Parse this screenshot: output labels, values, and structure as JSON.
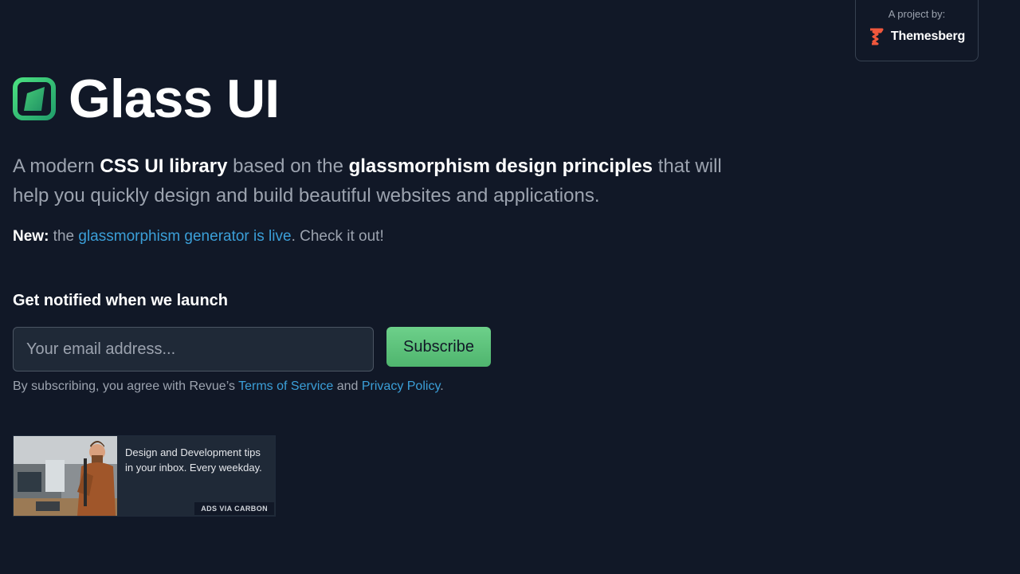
{
  "project": {
    "label": "A project by:",
    "name": "Themesberg"
  },
  "hero": {
    "title": "Glass UI",
    "lead_1": "A modern ",
    "lead_strong_1": "CSS UI library",
    "lead_2": " based on the ",
    "lead_strong_2": "glassmorphism design principles",
    "lead_3": " that will help you quickly design and build beautiful websites and applications."
  },
  "news": {
    "prefix": "New:",
    "text_1": " the ",
    "link": "glassmorphism generator is live",
    "text_2": ". Check it out!"
  },
  "newsletter": {
    "title": "Get notified when we launch",
    "email_placeholder": "Your email address...",
    "email_value": "",
    "subscribe_label": "Subscribe",
    "terms_1": "By subscribing, you agree with Revue’s ",
    "terms_link_1": "Terms of Service",
    "terms_2": " and ",
    "terms_link_2": "Privacy Policy",
    "terms_3": "."
  },
  "ad": {
    "text": "Design and Development tips in your inbox. Every weekday.",
    "credit": "ADS VIA CARBON"
  },
  "colors": {
    "background": "#111827",
    "accent_green": "#5cc27b",
    "link_blue": "#3b9fd8",
    "brand_orange": "#f0573c"
  },
  "icons": {
    "logo": "glass-ui-logo-icon",
    "brand": "themesberg-logo-icon"
  }
}
